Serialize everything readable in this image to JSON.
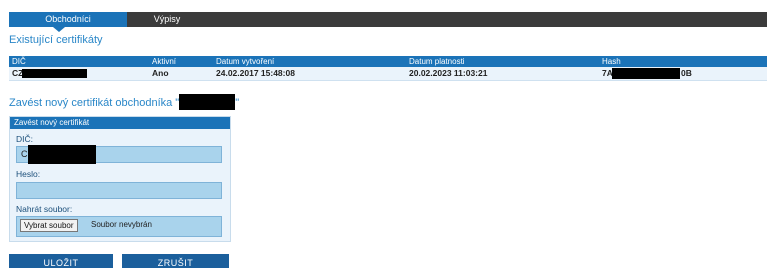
{
  "tabs": [
    {
      "label": "Obchodníci",
      "active": true
    },
    {
      "label": "Výpisy",
      "active": false
    }
  ],
  "existing_title": "Existující certifikáty",
  "table": {
    "headers": [
      "DIČ",
      "Aktivní",
      "Datum vytvoření",
      "Datum platnosti",
      "Hash"
    ],
    "rows": [
      {
        "dic": "CZ",
        "active": "Ano",
        "created": "24.02.2017 15:48:08",
        "valid": "20.02.2023 11:03:21",
        "hash_start": "7A",
        "hash_end": "0B"
      }
    ]
  },
  "new_cert_title": "Zavést nový certifikát obchodníka \"",
  "new_cert_title_end": "\"",
  "form": {
    "panel_title": "Zavést nový certifikát",
    "dic_label": "DIČ:",
    "dic_value": "C",
    "password_label": "Heslo:",
    "upload_label": "Nahrát soubor:",
    "choose_file_button": "Vybrat soubor",
    "no_file_text": "Soubor nevybrán"
  },
  "buttons": {
    "save": "ULOŽIT",
    "cancel": "ZRUŠIT"
  },
  "colors": {
    "accent": "#1b73b8",
    "tabbar": "#3b3b3b",
    "title": "#2a87c8",
    "input_bg": "#a9d3ec"
  }
}
